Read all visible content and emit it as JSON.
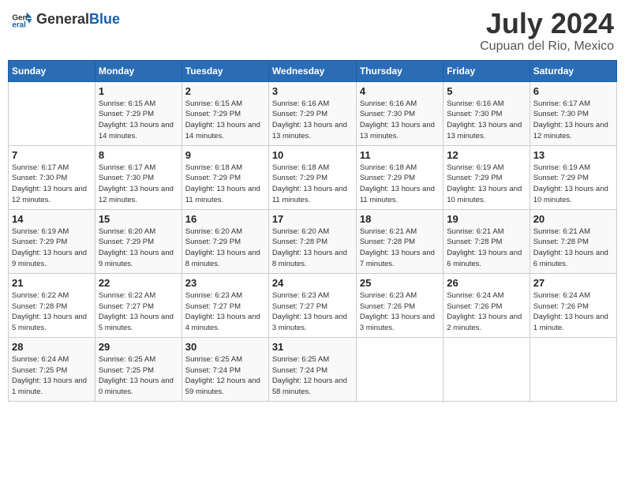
{
  "header": {
    "logo_general": "General",
    "logo_blue": "Blue",
    "month_year": "July 2024",
    "location": "Cupuan del Rio, Mexico"
  },
  "calendar": {
    "days_of_week": [
      "Sunday",
      "Monday",
      "Tuesday",
      "Wednesday",
      "Thursday",
      "Friday",
      "Saturday"
    ],
    "weeks": [
      [
        {
          "day": "",
          "sunrise": "",
          "sunset": "",
          "daylight": ""
        },
        {
          "day": "1",
          "sunrise": "6:15 AM",
          "sunset": "7:29 PM",
          "daylight": "13 hours and 14 minutes."
        },
        {
          "day": "2",
          "sunrise": "6:15 AM",
          "sunset": "7:29 PM",
          "daylight": "13 hours and 14 minutes."
        },
        {
          "day": "3",
          "sunrise": "6:16 AM",
          "sunset": "7:29 PM",
          "daylight": "13 hours and 13 minutes."
        },
        {
          "day": "4",
          "sunrise": "6:16 AM",
          "sunset": "7:30 PM",
          "daylight": "13 hours and 13 minutes."
        },
        {
          "day": "5",
          "sunrise": "6:16 AM",
          "sunset": "7:30 PM",
          "daylight": "13 hours and 13 minutes."
        },
        {
          "day": "6",
          "sunrise": "6:17 AM",
          "sunset": "7:30 PM",
          "daylight": "13 hours and 12 minutes."
        }
      ],
      [
        {
          "day": "7",
          "sunrise": "6:17 AM",
          "sunset": "7:30 PM",
          "daylight": "13 hours and 12 minutes."
        },
        {
          "day": "8",
          "sunrise": "6:17 AM",
          "sunset": "7:30 PM",
          "daylight": "13 hours and 12 minutes."
        },
        {
          "day": "9",
          "sunrise": "6:18 AM",
          "sunset": "7:29 PM",
          "daylight": "13 hours and 11 minutes."
        },
        {
          "day": "10",
          "sunrise": "6:18 AM",
          "sunset": "7:29 PM",
          "daylight": "13 hours and 11 minutes."
        },
        {
          "day": "11",
          "sunrise": "6:18 AM",
          "sunset": "7:29 PM",
          "daylight": "13 hours and 11 minutes."
        },
        {
          "day": "12",
          "sunrise": "6:19 AM",
          "sunset": "7:29 PM",
          "daylight": "13 hours and 10 minutes."
        },
        {
          "day": "13",
          "sunrise": "6:19 AM",
          "sunset": "7:29 PM",
          "daylight": "13 hours and 10 minutes."
        }
      ],
      [
        {
          "day": "14",
          "sunrise": "6:19 AM",
          "sunset": "7:29 PM",
          "daylight": "13 hours and 9 minutes."
        },
        {
          "day": "15",
          "sunrise": "6:20 AM",
          "sunset": "7:29 PM",
          "daylight": "13 hours and 9 minutes."
        },
        {
          "day": "16",
          "sunrise": "6:20 AM",
          "sunset": "7:29 PM",
          "daylight": "13 hours and 8 minutes."
        },
        {
          "day": "17",
          "sunrise": "6:20 AM",
          "sunset": "7:28 PM",
          "daylight": "13 hours and 8 minutes."
        },
        {
          "day": "18",
          "sunrise": "6:21 AM",
          "sunset": "7:28 PM",
          "daylight": "13 hours and 7 minutes."
        },
        {
          "day": "19",
          "sunrise": "6:21 AM",
          "sunset": "7:28 PM",
          "daylight": "13 hours and 6 minutes."
        },
        {
          "day": "20",
          "sunrise": "6:21 AM",
          "sunset": "7:28 PM",
          "daylight": "13 hours and 6 minutes."
        }
      ],
      [
        {
          "day": "21",
          "sunrise": "6:22 AM",
          "sunset": "7:28 PM",
          "daylight": "13 hours and 5 minutes."
        },
        {
          "day": "22",
          "sunrise": "6:22 AM",
          "sunset": "7:27 PM",
          "daylight": "13 hours and 5 minutes."
        },
        {
          "day": "23",
          "sunrise": "6:23 AM",
          "sunset": "7:27 PM",
          "daylight": "13 hours and 4 minutes."
        },
        {
          "day": "24",
          "sunrise": "6:23 AM",
          "sunset": "7:27 PM",
          "daylight": "13 hours and 3 minutes."
        },
        {
          "day": "25",
          "sunrise": "6:23 AM",
          "sunset": "7:26 PM",
          "daylight": "13 hours and 3 minutes."
        },
        {
          "day": "26",
          "sunrise": "6:24 AM",
          "sunset": "7:26 PM",
          "daylight": "13 hours and 2 minutes."
        },
        {
          "day": "27",
          "sunrise": "6:24 AM",
          "sunset": "7:26 PM",
          "daylight": "13 hours and 1 minute."
        }
      ],
      [
        {
          "day": "28",
          "sunrise": "6:24 AM",
          "sunset": "7:25 PM",
          "daylight": "13 hours and 1 minute."
        },
        {
          "day": "29",
          "sunrise": "6:25 AM",
          "sunset": "7:25 PM",
          "daylight": "13 hours and 0 minutes."
        },
        {
          "day": "30",
          "sunrise": "6:25 AM",
          "sunset": "7:24 PM",
          "daylight": "12 hours and 59 minutes."
        },
        {
          "day": "31",
          "sunrise": "6:25 AM",
          "sunset": "7:24 PM",
          "daylight": "12 hours and 58 minutes."
        },
        {
          "day": "",
          "sunrise": "",
          "sunset": "",
          "daylight": ""
        },
        {
          "day": "",
          "sunrise": "",
          "sunset": "",
          "daylight": ""
        },
        {
          "day": "",
          "sunrise": "",
          "sunset": "",
          "daylight": ""
        }
      ]
    ],
    "labels": {
      "sunrise": "Sunrise:",
      "sunset": "Sunset:",
      "daylight": "Daylight:"
    }
  }
}
